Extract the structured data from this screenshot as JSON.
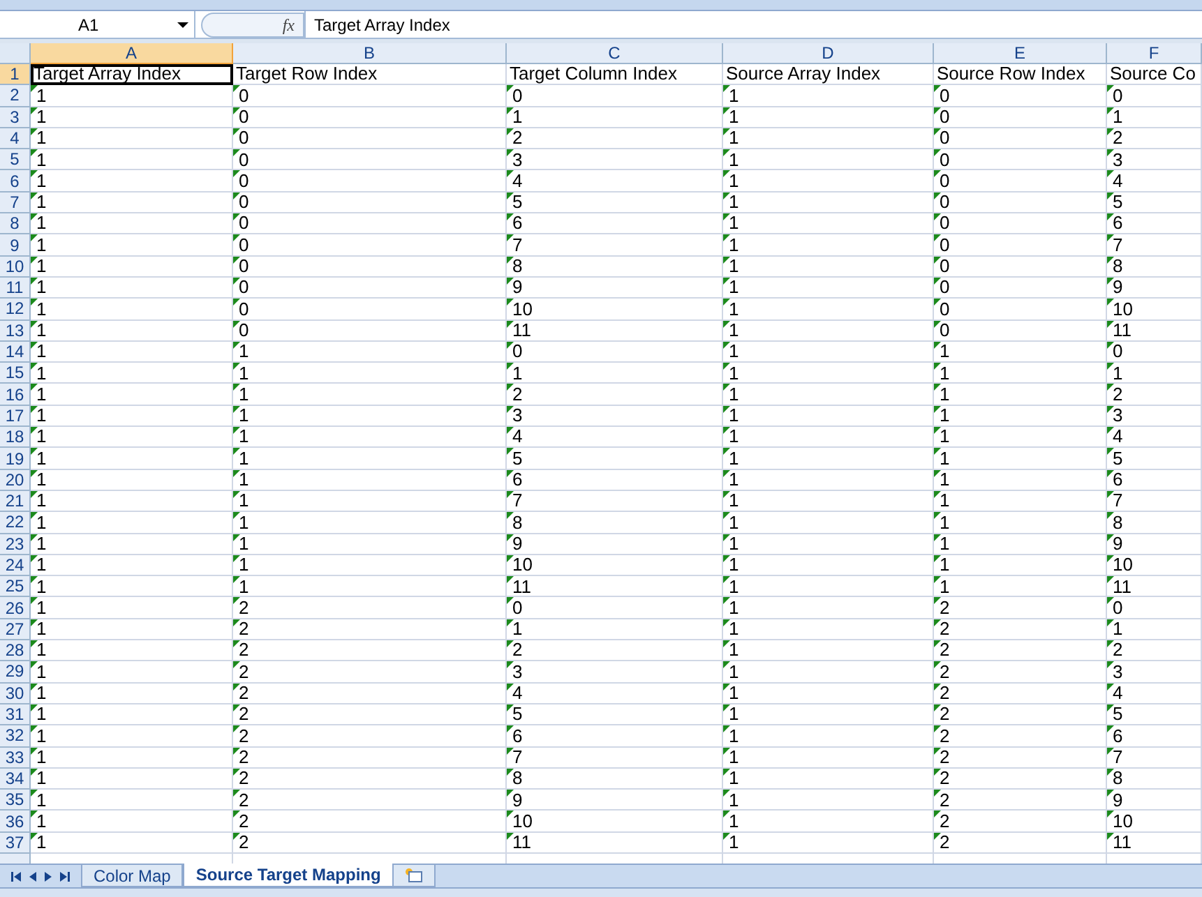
{
  "formula_bar": {
    "name_box": "A1",
    "function_symbol": "fx",
    "formula": "Target Array Index"
  },
  "columns": [
    {
      "letter": "A",
      "selected": true
    },
    {
      "letter": "B",
      "selected": false
    },
    {
      "letter": "C",
      "selected": false
    },
    {
      "letter": "D",
      "selected": false
    },
    {
      "letter": "E",
      "selected": false
    },
    {
      "letter": "F",
      "selected": false
    }
  ],
  "header_row": {
    "number": "1",
    "selected": true,
    "cells": [
      "Target Array Index",
      "Target Row Index",
      "Target Column Index",
      "Source Array Index",
      "Source Row Index",
      "Source Co"
    ]
  },
  "rows": [
    {
      "number": "2",
      "selected": false,
      "flagged": true,
      "cells": [
        "1",
        "0",
        "0",
        "1",
        "0",
        "0"
      ]
    },
    {
      "number": "3",
      "selected": false,
      "flagged": true,
      "cells": [
        "1",
        "0",
        "1",
        "1",
        "0",
        "1"
      ]
    },
    {
      "number": "4",
      "selected": false,
      "flagged": true,
      "cells": [
        "1",
        "0",
        "2",
        "1",
        "0",
        "2"
      ]
    },
    {
      "number": "5",
      "selected": false,
      "flagged": true,
      "cells": [
        "1",
        "0",
        "3",
        "1",
        "0",
        "3"
      ]
    },
    {
      "number": "6",
      "selected": false,
      "flagged": true,
      "cells": [
        "1",
        "0",
        "4",
        "1",
        "0",
        "4"
      ]
    },
    {
      "number": "7",
      "selected": false,
      "flagged": true,
      "cells": [
        "1",
        "0",
        "5",
        "1",
        "0",
        "5"
      ]
    },
    {
      "number": "8",
      "selected": false,
      "flagged": true,
      "cells": [
        "1",
        "0",
        "6",
        "1",
        "0",
        "6"
      ]
    },
    {
      "number": "9",
      "selected": false,
      "flagged": true,
      "cells": [
        "1",
        "0",
        "7",
        "1",
        "0",
        "7"
      ]
    },
    {
      "number": "10",
      "selected": false,
      "flagged": true,
      "cells": [
        "1",
        "0",
        "8",
        "1",
        "0",
        "8"
      ]
    },
    {
      "number": "11",
      "selected": false,
      "flagged": true,
      "cells": [
        "1",
        "0",
        "9",
        "1",
        "0",
        "9"
      ]
    },
    {
      "number": "12",
      "selected": false,
      "flagged": true,
      "cells": [
        "1",
        "0",
        "10",
        "1",
        "0",
        "10"
      ]
    },
    {
      "number": "13",
      "selected": false,
      "flagged": true,
      "cells": [
        "1",
        "0",
        "11",
        "1",
        "0",
        "11"
      ]
    },
    {
      "number": "14",
      "selected": false,
      "flagged": true,
      "cells": [
        "1",
        "1",
        "0",
        "1",
        "1",
        "0"
      ]
    },
    {
      "number": "15",
      "selected": false,
      "flagged": true,
      "cells": [
        "1",
        "1",
        "1",
        "1",
        "1",
        "1"
      ]
    },
    {
      "number": "16",
      "selected": false,
      "flagged": true,
      "cells": [
        "1",
        "1",
        "2",
        "1",
        "1",
        "2"
      ]
    },
    {
      "number": "17",
      "selected": false,
      "flagged": true,
      "cells": [
        "1",
        "1",
        "3",
        "1",
        "1",
        "3"
      ]
    },
    {
      "number": "18",
      "selected": false,
      "flagged": true,
      "cells": [
        "1",
        "1",
        "4",
        "1",
        "1",
        "4"
      ]
    },
    {
      "number": "19",
      "selected": false,
      "flagged": true,
      "cells": [
        "1",
        "1",
        "5",
        "1",
        "1",
        "5"
      ]
    },
    {
      "number": "20",
      "selected": false,
      "flagged": true,
      "cells": [
        "1",
        "1",
        "6",
        "1",
        "1",
        "6"
      ]
    },
    {
      "number": "21",
      "selected": false,
      "flagged": true,
      "cells": [
        "1",
        "1",
        "7",
        "1",
        "1",
        "7"
      ]
    },
    {
      "number": "22",
      "selected": false,
      "flagged": true,
      "cells": [
        "1",
        "1",
        "8",
        "1",
        "1",
        "8"
      ]
    },
    {
      "number": "23",
      "selected": false,
      "flagged": true,
      "cells": [
        "1",
        "1",
        "9",
        "1",
        "1",
        "9"
      ]
    },
    {
      "number": "24",
      "selected": false,
      "flagged": true,
      "cells": [
        "1",
        "1",
        "10",
        "1",
        "1",
        "10"
      ]
    },
    {
      "number": "25",
      "selected": false,
      "flagged": true,
      "cells": [
        "1",
        "1",
        "11",
        "1",
        "1",
        "11"
      ]
    },
    {
      "number": "26",
      "selected": false,
      "flagged": true,
      "cells": [
        "1",
        "2",
        "0",
        "1",
        "2",
        "0"
      ]
    },
    {
      "number": "27",
      "selected": false,
      "flagged": true,
      "cells": [
        "1",
        "2",
        "1",
        "1",
        "2",
        "1"
      ]
    },
    {
      "number": "28",
      "selected": false,
      "flagged": true,
      "cells": [
        "1",
        "2",
        "2",
        "1",
        "2",
        "2"
      ]
    },
    {
      "number": "29",
      "selected": false,
      "flagged": true,
      "cells": [
        "1",
        "2",
        "3",
        "1",
        "2",
        "3"
      ]
    },
    {
      "number": "30",
      "selected": false,
      "flagged": true,
      "cells": [
        "1",
        "2",
        "4",
        "1",
        "2",
        "4"
      ]
    },
    {
      "number": "31",
      "selected": false,
      "flagged": true,
      "cells": [
        "1",
        "2",
        "5",
        "1",
        "2",
        "5"
      ]
    },
    {
      "number": "32",
      "selected": false,
      "flagged": true,
      "cells": [
        "1",
        "2",
        "6",
        "1",
        "2",
        "6"
      ]
    },
    {
      "number": "33",
      "selected": false,
      "flagged": true,
      "cells": [
        "1",
        "2",
        "7",
        "1",
        "2",
        "7"
      ]
    },
    {
      "number": "34",
      "selected": false,
      "flagged": true,
      "cells": [
        "1",
        "2",
        "8",
        "1",
        "2",
        "8"
      ]
    },
    {
      "number": "35",
      "selected": false,
      "flagged": true,
      "cells": [
        "1",
        "2",
        "9",
        "1",
        "2",
        "9"
      ]
    },
    {
      "number": "36",
      "selected": false,
      "flagged": true,
      "cells": [
        "1",
        "2",
        "10",
        "1",
        "2",
        "10"
      ]
    },
    {
      "number": "37",
      "selected": false,
      "flagged": true,
      "cells": [
        "1",
        "2",
        "11",
        "1",
        "2",
        "11"
      ]
    }
  ],
  "sheet_tabs": [
    {
      "label": "Color Map",
      "selected": false
    },
    {
      "label": "Source Target Mapping",
      "selected": true
    }
  ]
}
